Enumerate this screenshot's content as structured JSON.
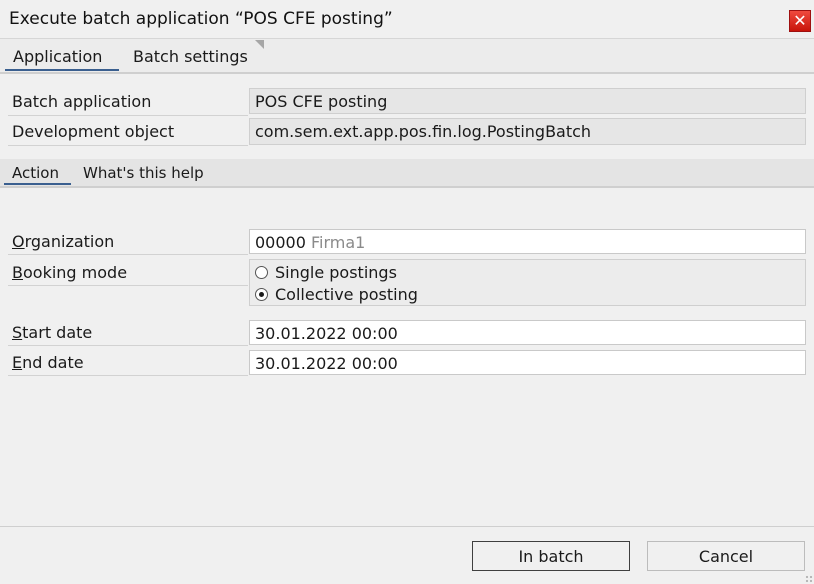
{
  "window": {
    "title": "Execute batch application “POS CFE posting”",
    "close_icon": "close-icon",
    "close_color": "#d62516"
  },
  "tabs": [
    {
      "label": "Application",
      "active": true
    },
    {
      "label": "Batch settings",
      "active": false
    }
  ],
  "info": {
    "batch_application_label": "Batch application",
    "batch_application_value": "POS CFE posting",
    "development_object_label": "Development object",
    "development_object_value": "com.sem.ext.app.pos.fin.log.PostingBatch"
  },
  "subtabs": [
    {
      "label": "Action",
      "active": true
    },
    {
      "label": "What's this help",
      "active": false
    }
  ],
  "form": {
    "organization": {
      "label_first": "O",
      "label_rest": "rganization",
      "code": "00000",
      "name": "Firma1"
    },
    "booking_mode": {
      "label_first": "B",
      "label_rest": "ooking mode",
      "options": [
        {
          "label": "Single postings",
          "selected": false
        },
        {
          "label": "Collective posting",
          "selected": true
        }
      ]
    },
    "start_date": {
      "label_first": "S",
      "label_rest": "tart date",
      "value": "30.01.2022 00:00"
    },
    "end_date": {
      "label_first": "E",
      "label_rest": "nd date",
      "value": "30.01.2022 00:00"
    }
  },
  "buttons": {
    "in_batch": "In batch",
    "cancel": "Cancel"
  },
  "colors": {
    "accent": "#3a5f8f",
    "background": "#f0f0f0"
  }
}
